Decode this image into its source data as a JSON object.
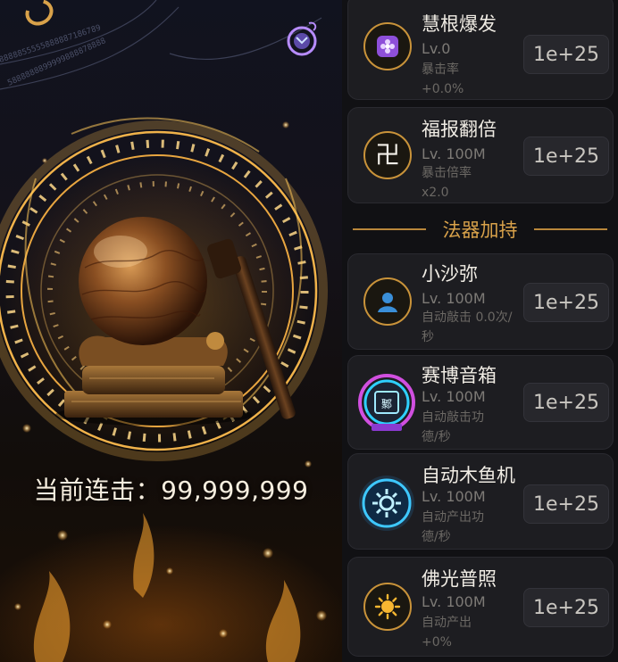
{
  "scene": {
    "combo_label": "当前连击：",
    "combo_value": "99,999,999",
    "instrument": "wooden-fish-icon",
    "mallet": "mallet-icon",
    "rune_ring": "rune-ring-icon"
  },
  "panel": {
    "accent": "#d9a24a",
    "section_title": "法器加持",
    "skills": [
      {
        "name": "慧根爆发",
        "level": "Lv.0",
        "desc": "暴击率+0.0%",
        "cost": "1e+25",
        "icon": "lotus-icon"
      },
      {
        "name": "福报翻倍",
        "level": "Lv. 100M",
        "desc": "暴击倍率x2.0",
        "cost": "1e+25",
        "icon": "swastika-icon"
      }
    ],
    "items": [
      {
        "name": "小沙弥",
        "level": "Lv. 100M",
        "desc": "自动敲击 0.0次/秒",
        "cost": "1e+25",
        "icon": "monk-icon"
      },
      {
        "name": "赛博音箱",
        "level": "Lv. 100M",
        "desc": "自动敲击功德/秒",
        "cost": "1e+25",
        "icon": "speaker-icon"
      },
      {
        "name": "自动木鱼机",
        "level": "Lv. 100M",
        "desc": "自动产出功德/秒",
        "cost": "1e+25",
        "icon": "gear-icon"
      },
      {
        "name": "佛光普照",
        "level": "Lv. 100M",
        "desc": "自动产出+0%",
        "cost": "1e+25",
        "icon": "sun-icon"
      }
    ]
  }
}
